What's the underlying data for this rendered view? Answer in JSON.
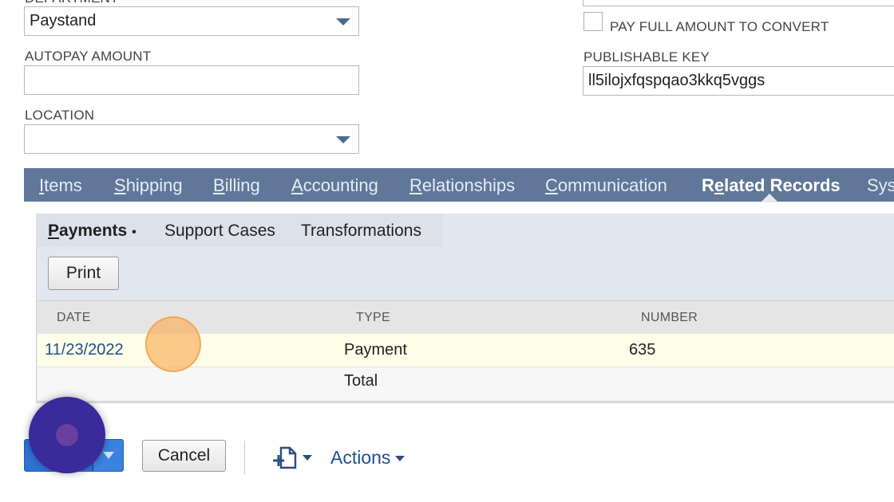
{
  "form": {
    "department": {
      "label": "DEPARTMENT",
      "value": "Paystand"
    },
    "autopay_amount": {
      "label": "AUTOPAY AMOUNT",
      "value": ""
    },
    "location": {
      "label": "LOCATION",
      "value": ""
    },
    "pay_full_amount": {
      "label": "PAY FULL AMOUNT TO CONVERT",
      "checked": false
    },
    "publishable_key": {
      "label": "PUBLISHABLE KEY",
      "value": "ll5ilojxfqspqao3kkq5vggs"
    }
  },
  "tabs": [
    {
      "label": "Items",
      "underline_index": 0
    },
    {
      "label": "Shipping",
      "underline_index": 0
    },
    {
      "label": "Billing",
      "underline_index": 0
    },
    {
      "label": "Accounting",
      "underline_index": 0
    },
    {
      "label": "Relationships",
      "underline_index": 0
    },
    {
      "label": "Communication",
      "underline_index": 0
    },
    {
      "label": "Related Records",
      "underline_index": 1,
      "active": true
    },
    {
      "label": "Syst",
      "underline_index": -1
    }
  ],
  "subtabs": {
    "payments": "Payments",
    "payments_marker": "•",
    "support_cases": "Support Cases",
    "transformations": "Transformations"
  },
  "toolbar": {
    "print_label": "Print"
  },
  "table": {
    "columns": [
      "DATE",
      "TYPE",
      "NUMBER"
    ],
    "rows": [
      {
        "date": "11/23/2022",
        "type": "Payment",
        "number": "635"
      }
    ],
    "total_label": "Total"
  },
  "footer": {
    "cancel_label": "Cancel",
    "actions_label": "Actions"
  },
  "colors": {
    "tab_bar": "#607799",
    "panel_bg": "#e3e7ef",
    "link": "#1f4f8c",
    "primary_button": "#2f73d6",
    "click_marker": "#f9b25f",
    "cursor_marker": "#3a2a9a"
  }
}
